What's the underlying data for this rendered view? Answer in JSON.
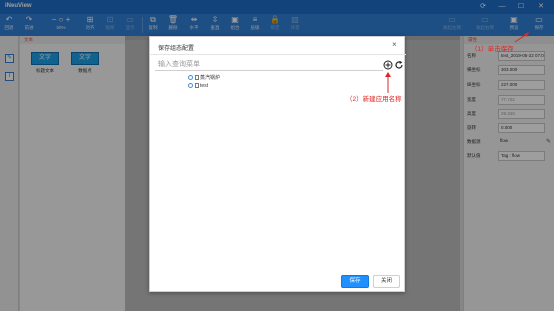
{
  "app": {
    "title": "iNeuView"
  },
  "toolbar": {
    "left": [
      {
        "label": "回退",
        "icon": "undo-icon",
        "glyph": "↶"
      },
      {
        "label": "前进",
        "icon": "redo-icon",
        "glyph": "↷"
      },
      {
        "label": "50%",
        "icon": "zoom-icon",
        "glyph": "− ○ +"
      },
      {
        "label": "对齐",
        "icon": "align-icon",
        "glyph": "⊞"
      },
      {
        "label": "吸附",
        "icon": "snap-icon",
        "glyph": "⊡"
      },
      {
        "label": "显示",
        "icon": "show-icon",
        "glyph": "▭"
      },
      {
        "label": "复制",
        "icon": "copy-icon",
        "glyph": "⧉"
      },
      {
        "label": "删除",
        "icon": "delete-icon",
        "glyph": "🗑"
      },
      {
        "label": "水平",
        "icon": "horizontal-icon",
        "glyph": "⇹"
      },
      {
        "label": "垂直",
        "icon": "vertical-icon",
        "glyph": "⇳"
      },
      {
        "label": "组合",
        "icon": "group-icon",
        "glyph": "▣"
      },
      {
        "label": "层级",
        "icon": "layer-icon",
        "glyph": "≡"
      },
      {
        "label": "锁定",
        "icon": "lock-icon",
        "glyph": "🔒"
      },
      {
        "label": "背景",
        "icon": "background-icon",
        "glyph": "▨"
      }
    ],
    "right": [
      {
        "label": "收起左侧",
        "icon": "collapse-left-icon",
        "glyph": "▭"
      },
      {
        "label": "收起右侧",
        "icon": "collapse-right-icon",
        "glyph": "▭"
      },
      {
        "label": "预览",
        "icon": "preview-icon",
        "glyph": "▣"
      },
      {
        "label": "保存",
        "icon": "save-icon",
        "glyph": "▭"
      }
    ]
  },
  "left_panel": {
    "header": "文本",
    "components": [
      {
        "box_text": "文字",
        "caption": "标题文本"
      },
      {
        "box_text": "文字",
        "caption": "数据点"
      }
    ]
  },
  "right_panel": {
    "header": "属性",
    "rows": [
      {
        "key": "名称",
        "value": "text_2019-05-22 07:05"
      },
      {
        "key": "横坐标",
        "value": "303.000"
      },
      {
        "key": "纵坐标",
        "value": "227.000"
      },
      {
        "key": "宽度",
        "value": "77.722"
      },
      {
        "key": "高度",
        "value": "29.340"
      },
      {
        "key": "旋转",
        "value": "0.000"
      },
      {
        "key": "数据源",
        "value": "flow"
      },
      {
        "key": "默认值",
        "value": "Tag : flow"
      }
    ]
  },
  "annotations": {
    "click_save": "（1）单击保存",
    "new_app_name": "（2）新建应用名称"
  },
  "dialog": {
    "title": "保存组态配置",
    "close": "×",
    "search_placeholder": "输入查询菜单",
    "tree": [
      "蒸汽锅炉",
      "test"
    ],
    "save_button": "保存",
    "close_button": "关闭"
  },
  "colors": {
    "titlebar": "#1e6fc7",
    "toolbar": "#2f7fd6",
    "primary_button": "#1e90ff",
    "annotation": "#e02424"
  }
}
